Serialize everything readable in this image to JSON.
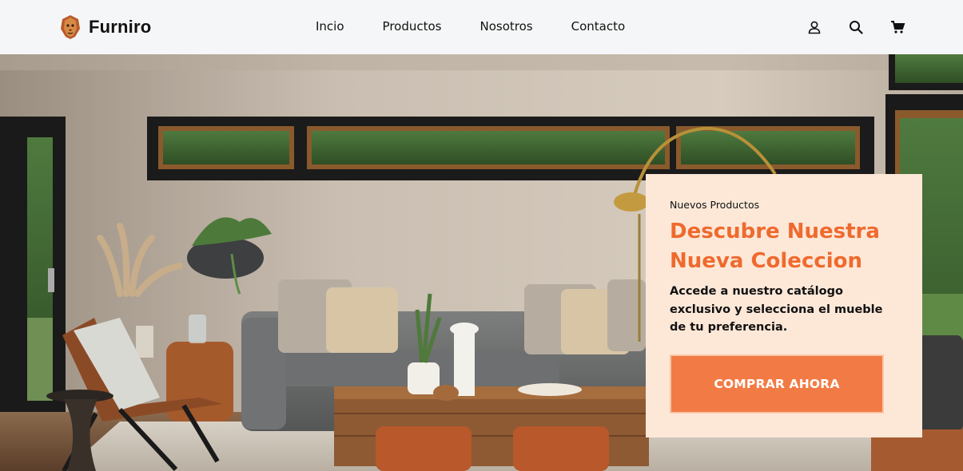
{
  "brand": {
    "name": "Furniro",
    "logo_icon": "lion-head-logo"
  },
  "nav": {
    "items": [
      {
        "label": "Incio"
      },
      {
        "label": "Productos"
      },
      {
        "label": "Nosotros"
      },
      {
        "label": "Contacto"
      }
    ]
  },
  "header_icons": [
    "user-icon",
    "search-icon",
    "cart-icon"
  ],
  "hero": {
    "tag": "Nuevos Productos",
    "title_line1": "Descubre Nuestra",
    "title_line2": "Nueva Coleccion",
    "description": "Accede a nuestro catálogo exclusivo y selecciona el mueble de tu preferencia.",
    "cta_label": "COMPRAR AHORA",
    "background_image": "living-room-photo"
  },
  "colors": {
    "accent": "#ef6a2e",
    "button": "#f27b45",
    "card_bg": "#fde8d8",
    "header_bg": "#f5f6f7"
  }
}
